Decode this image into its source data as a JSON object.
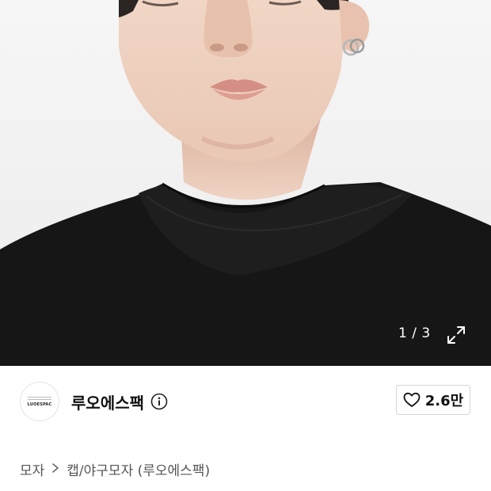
{
  "gallery": {
    "current": "1",
    "total": "3",
    "counter_text": "1 / 3",
    "expand_icon": "expand-arrows-icon"
  },
  "brand": {
    "logo_text": "LUOESPAC",
    "name": "루오에스팩",
    "info_icon": "info-circle-icon",
    "likes": "2.6만",
    "like_icon": "heart-outline-icon"
  },
  "breadcrumb": {
    "items": [
      "모자",
      "캡/야구모자 (루오에스팩)"
    ],
    "separator_icon": "chevron-right-icon"
  },
  "colors": {
    "shirt": "#161616",
    "background": "#ffffff",
    "text_muted": "#555555"
  }
}
